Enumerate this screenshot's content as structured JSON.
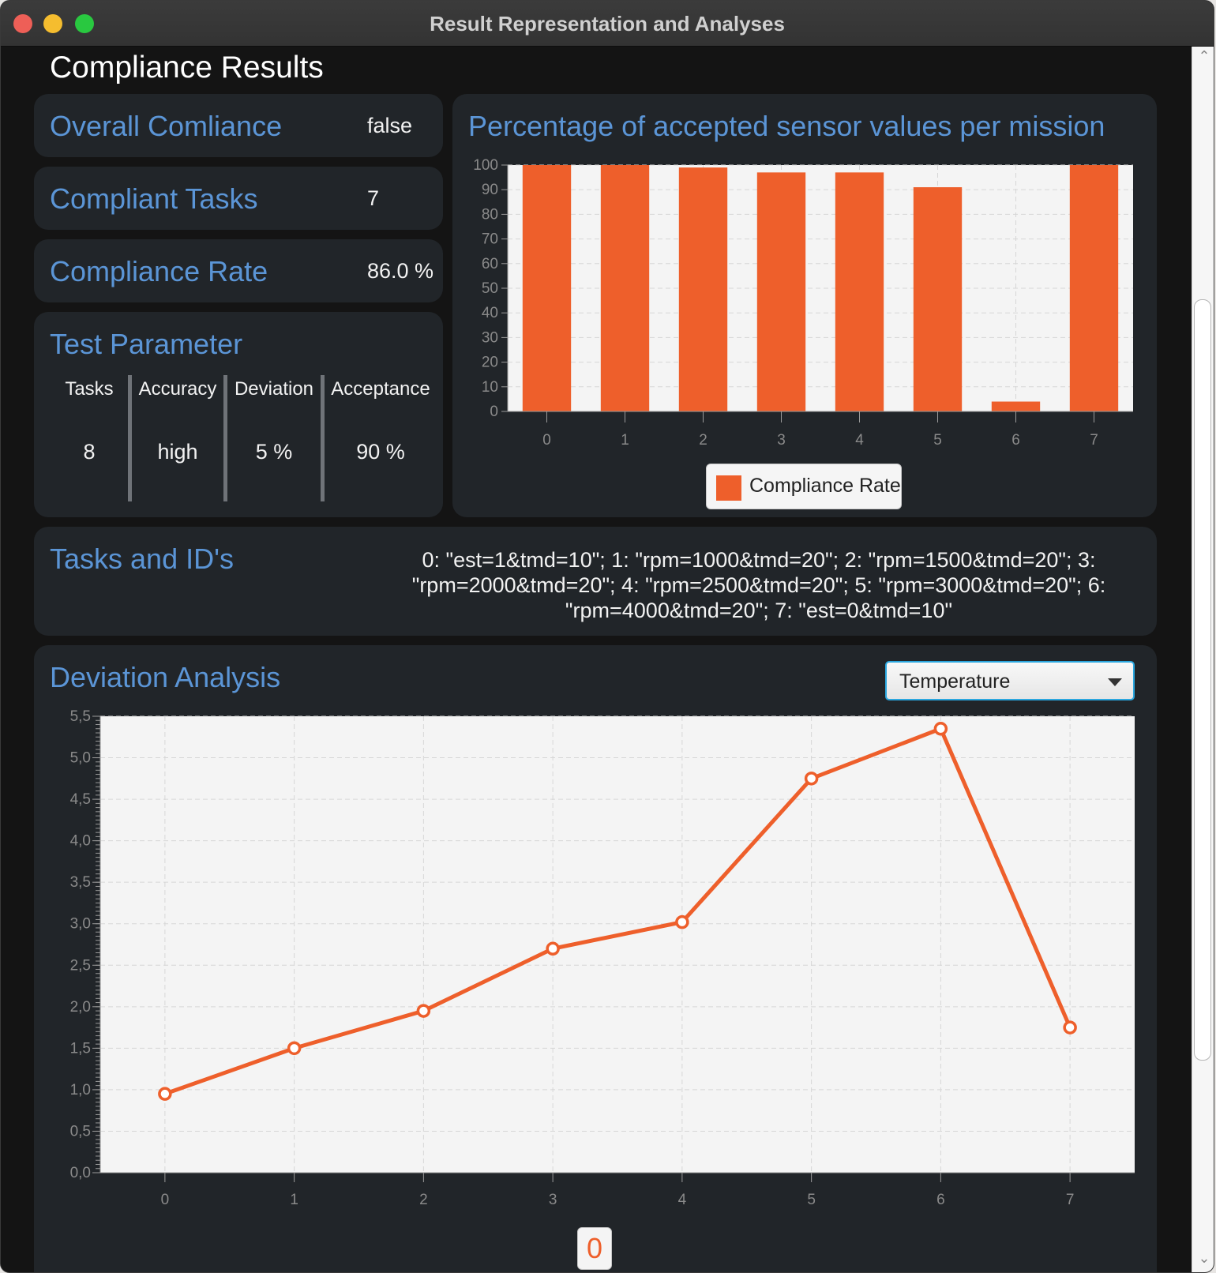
{
  "window": {
    "title": "Result Representation and Analyses"
  },
  "page_title": "Compliance Results",
  "summary": {
    "overall_label": "Overall Comliance",
    "overall_value": "false",
    "tasks_label": "Compliant Tasks",
    "tasks_value": "7",
    "rate_label": "Compliance Rate",
    "rate_value": "86.0 %"
  },
  "test_parameter": {
    "title": "Test Parameter",
    "headers": [
      "Tasks",
      "Accuracy",
      "Deviation",
      "Acceptance"
    ],
    "values": [
      "8",
      "high",
      "5 %",
      "90 %"
    ]
  },
  "tasks_ids": {
    "title": "Tasks and ID's",
    "text": "0: \"est=1&tmd=10\"; 1: \"rpm=1000&tmd=20\"; 2: \"rpm=1500&tmd=20\"; 3: \"rpm=2000&tmd=20\"; 4: \"rpm=2500&tmd=20\"; 5: \"rpm=3000&tmd=20\"; 6: \"rpm=4000&tmd=20\"; 7: \"est=0&tmd=10\""
  },
  "deviation": {
    "title": "Deviation Analysis",
    "selected": "Temperature",
    "page_button": "0"
  },
  "chart_data": [
    {
      "type": "bar",
      "title": "Percentage of accepted sensor values per mission",
      "categories": [
        "0",
        "1",
        "2",
        "3",
        "4",
        "5",
        "6",
        "7"
      ],
      "series": [
        {
          "name": "Compliance Rate",
          "values": [
            100,
            100,
            99,
            97,
            97,
            91,
            4,
            100
          ],
          "color": "#ee5f2b"
        }
      ],
      "ylim": [
        0,
        100
      ],
      "yticks": [
        "0",
        "10",
        "20",
        "30",
        "40",
        "50",
        "60",
        "70",
        "80",
        "90",
        "100"
      ],
      "grid": true,
      "legend": "bottom-center"
    },
    {
      "type": "line",
      "title": "Deviation Analysis",
      "x": [
        0,
        1,
        2,
        3,
        4,
        5,
        6,
        7
      ],
      "series": [
        {
          "values": [
            0.95,
            1.5,
            1.95,
            2.7,
            3.02,
            4.75,
            5.35,
            1.75
          ],
          "color": "#ee5f2b"
        }
      ],
      "xticks": [
        "0",
        "1",
        "2",
        "3",
        "4",
        "5",
        "6",
        "7"
      ],
      "ylim": [
        0,
        5.5
      ],
      "yticks": [
        "0,0",
        "0,5",
        "1,0",
        "1,5",
        "2,0",
        "2,5",
        "3,0",
        "3,5",
        "4,0",
        "4,5",
        "5,0",
        "5,5"
      ],
      "grid": true
    }
  ]
}
